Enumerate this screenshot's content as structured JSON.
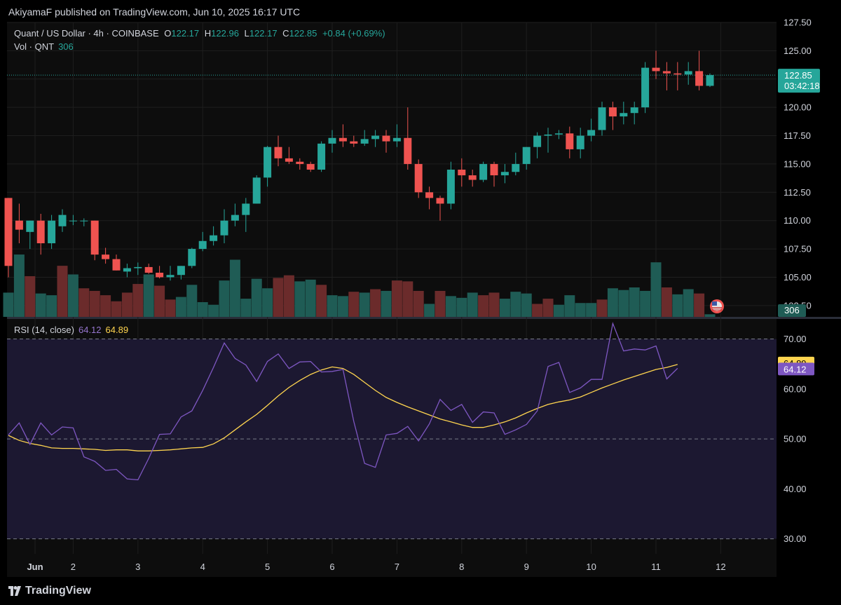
{
  "header": {
    "published": "AkiyamaF published on TradingView.com, Jun 10, 2025 16:17 UTC"
  },
  "legend": {
    "symbol": "Quant / US Dollar · 4h · COINBASE",
    "o_label": "O",
    "o": "122.17",
    "h_label": "H",
    "h": "122.96",
    "l_label": "L",
    "l": "122.17",
    "c_label": "C",
    "c": "122.85",
    "change": "+0.84 (+0.69%)",
    "vol_label": "Vol · QNT",
    "vol_value": "306"
  },
  "price_tag": {
    "price": "122.85",
    "countdown": "03:42:18"
  },
  "vol_tag": "306",
  "rsi_legend": {
    "label": "RSI (14, close)",
    "rsi": "64.12",
    "ma": "64.89"
  },
  "footer": {
    "brand": "TradingView"
  },
  "colors": {
    "up": "#26a69a",
    "down": "#ef5350",
    "rsi": "#7e57c2",
    "rsi_ma": "#ffd54f",
    "rsi_band": "#1c1831",
    "background": "#0d0d0d"
  },
  "chart_data": [
    {
      "type": "candlestick",
      "interval": "4h",
      "ylim": [
        101.5,
        127.5
      ],
      "y_ticks": [
        "127.50",
        "125.00",
        "122.50",
        "120.00",
        "117.50",
        "115.00",
        "112.50",
        "110.00",
        "107.50",
        "105.00",
        "102.50"
      ],
      "x_ticks": [
        {
          "label": "Jun",
          "t": 0
        },
        {
          "label": "2",
          "t": 6
        },
        {
          "label": "3",
          "t": 12
        },
        {
          "label": "4",
          "t": 18
        },
        {
          "label": "5",
          "t": 24
        },
        {
          "label": "6",
          "t": 30
        },
        {
          "label": "7",
          "t": 36
        },
        {
          "label": "8",
          "t": 42
        },
        {
          "label": "9",
          "t": 48
        },
        {
          "label": "10",
          "t": 54
        },
        {
          "label": "11",
          "t": 60
        },
        {
          "label": "12",
          "t": 66
        }
      ],
      "last_price": 122.85,
      "candles": [
        [
          112.0,
          112.0,
          105.0,
          106.0,
          600
        ],
        [
          110.0,
          111.5,
          108.0,
          109.2,
          450
        ],
        [
          109.0,
          110.0,
          107.5,
          110.0,
          500
        ],
        [
          110.0,
          110.6,
          107.0,
          108.0,
          420
        ],
        [
          108.0,
          110.5,
          107.5,
          110.0,
          380
        ],
        [
          109.5,
          111.0,
          109.0,
          110.5,
          430
        ],
        [
          110.0,
          110.5,
          109.6,
          110.0,
          380
        ],
        [
          110.0,
          110.2,
          109.5,
          110.0,
          320
        ],
        [
          110.0,
          110.0,
          106.5,
          107.0,
          390
        ],
        [
          107.0,
          107.6,
          106.2,
          106.6,
          530
        ],
        [
          106.6,
          107.0,
          105.6,
          105.6,
          430
        ],
        [
          105.5,
          106.2,
          105.0,
          105.8,
          480
        ],
        [
          105.8,
          106.3,
          105.2,
          105.9,
          420
        ],
        [
          105.9,
          106.2,
          105.3,
          105.4,
          400
        ],
        [
          105.4,
          106.0,
          104.9,
          105.0,
          310
        ],
        [
          105.0,
          106.0,
          104.7,
          105.2,
          350
        ],
        [
          105.2,
          106.0,
          104.8,
          106.0,
          340
        ],
        [
          106.0,
          107.6,
          105.8,
          107.5,
          380
        ],
        [
          107.5,
          109.0,
          107.3,
          108.2,
          420
        ],
        [
          108.2,
          109.5,
          107.8,
          108.7,
          480
        ],
        [
          108.7,
          111.0,
          108.0,
          110.0,
          520
        ],
        [
          110.0,
          111.5,
          109.5,
          110.5,
          560
        ],
        [
          110.5,
          112.0,
          109.0,
          111.5,
          410
        ],
        [
          111.5,
          114.0,
          111.5,
          113.8,
          420
        ],
        [
          113.8,
          116.6,
          113.0,
          116.5,
          610
        ],
        [
          116.5,
          117.5,
          114.8,
          115.5,
          570
        ],
        [
          115.5,
          116.5,
          115.0,
          115.2,
          560
        ],
        [
          115.2,
          115.5,
          114.5,
          115.0,
          520
        ],
        [
          115.0,
          115.2,
          114.3,
          114.5,
          460
        ],
        [
          114.5,
          117.0,
          114.3,
          116.8,
          510
        ],
        [
          116.8,
          118.0,
          116.0,
          117.3,
          380
        ],
        [
          117.3,
          118.5,
          116.5,
          117.0,
          320
        ],
        [
          117.0,
          117.5,
          116.5,
          116.8,
          370
        ],
        [
          116.8,
          118.0,
          116.6,
          117.2,
          340
        ],
        [
          117.2,
          118.0,
          116.5,
          117.5,
          400
        ],
        [
          117.5,
          118.0,
          116.0,
          117.0,
          430
        ],
        [
          117.0,
          118.5,
          116.5,
          117.3,
          460
        ],
        [
          117.3,
          120.0,
          114.5,
          115.0,
          510
        ],
        [
          115.0,
          115.4,
          112.0,
          112.5,
          440
        ],
        [
          112.5,
          113.0,
          111.0,
          112.0,
          500
        ],
        [
          112.0,
          112.2,
          110.0,
          111.5,
          430
        ],
        [
          111.5,
          115.2,
          111.0,
          114.5,
          520
        ],
        [
          114.5,
          115.5,
          113.0,
          114.0,
          550
        ],
        [
          114.0,
          114.5,
          113.0,
          113.6,
          490
        ],
        [
          113.6,
          115.2,
          113.4,
          115.0,
          430
        ],
        [
          115.0,
          115.2,
          113.0,
          114.0,
          380
        ],
        [
          114.0,
          115.0,
          113.3,
          114.3,
          460
        ],
        [
          114.3,
          116.0,
          114.0,
          115.0,
          410
        ],
        [
          115.0,
          116.5,
          114.5,
          116.5,
          390
        ],
        [
          116.5,
          117.8,
          115.5,
          117.5,
          400
        ],
        [
          117.5,
          118.2,
          116.0,
          117.6,
          350
        ],
        [
          117.6,
          118.0,
          117.2,
          117.7,
          300
        ],
        [
          117.7,
          118.3,
          115.5,
          116.3,
          410
        ],
        [
          116.3,
          118.2,
          115.5,
          117.5,
          430
        ],
        [
          117.5,
          119.0,
          117.0,
          118.0,
          450
        ],
        [
          118.0,
          120.5,
          117.5,
          120.0,
          560
        ],
        [
          120.0,
          120.5,
          118.0,
          119.2,
          600
        ],
        [
          119.2,
          120.5,
          118.5,
          119.5,
          620
        ],
        [
          119.5,
          120.5,
          118.5,
          120.0,
          720
        ],
        [
          120.0,
          124.0,
          119.5,
          123.5,
          850
        ],
        [
          123.5,
          125.0,
          122.5,
          123.2,
          780
        ],
        [
          123.2,
          124.0,
          121.5,
          123.0,
          850
        ],
        [
          123.0,
          124.0,
          121.5,
          122.9,
          700
        ],
        [
          122.9,
          124.0,
          122.0,
          123.2,
          760
        ],
        [
          123.2,
          125.0,
          121.5,
          121.9,
          690
        ],
        [
          121.9,
          123.0,
          121.8,
          122.85,
          306
        ]
      ],
      "volumes": [
        280,
        720,
        470,
        270,
        250,
        590,
        490,
        330,
        300,
        250,
        180,
        280,
        380,
        490,
        360,
        200,
        230,
        370,
        170,
        140,
        420,
        660,
        210,
        440,
        330,
        450,
        480,
        410,
        430,
        370,
        250,
        240,
        290,
        280,
        320,
        300,
        420,
        410,
        300,
        150,
        300,
        240,
        220,
        280,
        250,
        280,
        210,
        290,
        270,
        150,
        210,
        140,
        250,
        160,
        160,
        200,
        330,
        310,
        340,
        300,
        630,
        340,
        260,
        320,
        270,
        30
      ],
      "volume_directions": [
        "up",
        "up",
        "down",
        "up",
        "up",
        "down",
        "up",
        "down",
        "down",
        "down",
        "down",
        "down",
        "down",
        "up",
        "down",
        "down",
        "up",
        "up",
        "up",
        "up",
        "up",
        "up",
        "up",
        "up",
        "up",
        "down",
        "down",
        "up",
        "up",
        "down",
        "up",
        "up",
        "down",
        "up",
        "down",
        "up",
        "down",
        "down",
        "down",
        "up",
        "down",
        "up",
        "up",
        "up",
        "down",
        "down",
        "up",
        "up",
        "up",
        "down",
        "down",
        "up",
        "up",
        "up",
        "up",
        "down",
        "up",
        "up",
        "up",
        "up",
        "up",
        "down",
        "up",
        "up",
        "down",
        "up"
      ]
    },
    {
      "type": "line",
      "name": "RSI (14, close)",
      "ylim": [
        27,
        74
      ],
      "y_ticks": [
        "70.00",
        "60.00",
        "50.00",
        "40.00",
        "30.00"
      ],
      "bands": [
        70,
        50,
        30
      ],
      "series": [
        {
          "name": "RSI",
          "values": [
            50.8,
            53.2,
            48.9,
            53.2,
            50.8,
            52.4,
            52.2,
            46.4,
            45.5,
            43.7,
            43.9,
            42.0,
            41.8,
            46.1,
            50.9,
            51.0,
            54.4,
            55.6,
            59.7,
            64.3,
            69.2,
            66.1,
            64.8,
            61.5,
            65.5,
            67.0,
            64.1,
            65.4,
            65.5,
            63.4,
            63.5,
            63.9,
            53.5,
            45.1,
            44.3,
            50.8,
            51.1,
            52.5,
            49.6,
            53.0,
            57.9,
            55.7,
            56.9,
            53.3,
            55.4,
            55.2,
            50.9,
            51.8,
            52.9,
            55.6,
            64.5,
            65.3,
            59.3,
            60.2,
            61.9,
            61.9,
            73.1,
            67.6,
            68.0,
            67.8,
            68.6,
            62.0,
            64.12
          ]
        },
        {
          "name": "MA",
          "values": [
            50.7,
            49.7,
            49.1,
            48.7,
            48.2,
            48.1,
            48.1,
            48.0,
            47.9,
            47.7,
            47.8,
            47.8,
            47.6,
            47.6,
            47.7,
            47.8,
            48.0,
            48.2,
            48.3,
            49.0,
            50.2,
            51.8,
            53.4,
            54.9,
            56.7,
            58.6,
            60.3,
            61.7,
            62.9,
            63.8,
            64.4,
            64.1,
            62.9,
            61.3,
            59.7,
            58.3,
            57.3,
            56.4,
            55.6,
            54.8,
            54.0,
            53.4,
            52.8,
            52.3,
            52.3,
            52.8,
            53.4,
            54.2,
            55.2,
            56.1,
            56.9,
            57.4,
            57.8,
            58.4,
            59.3,
            60.2,
            61.0,
            61.8,
            62.5,
            63.2,
            63.9,
            64.3,
            64.89
          ]
        }
      ]
    }
  ]
}
